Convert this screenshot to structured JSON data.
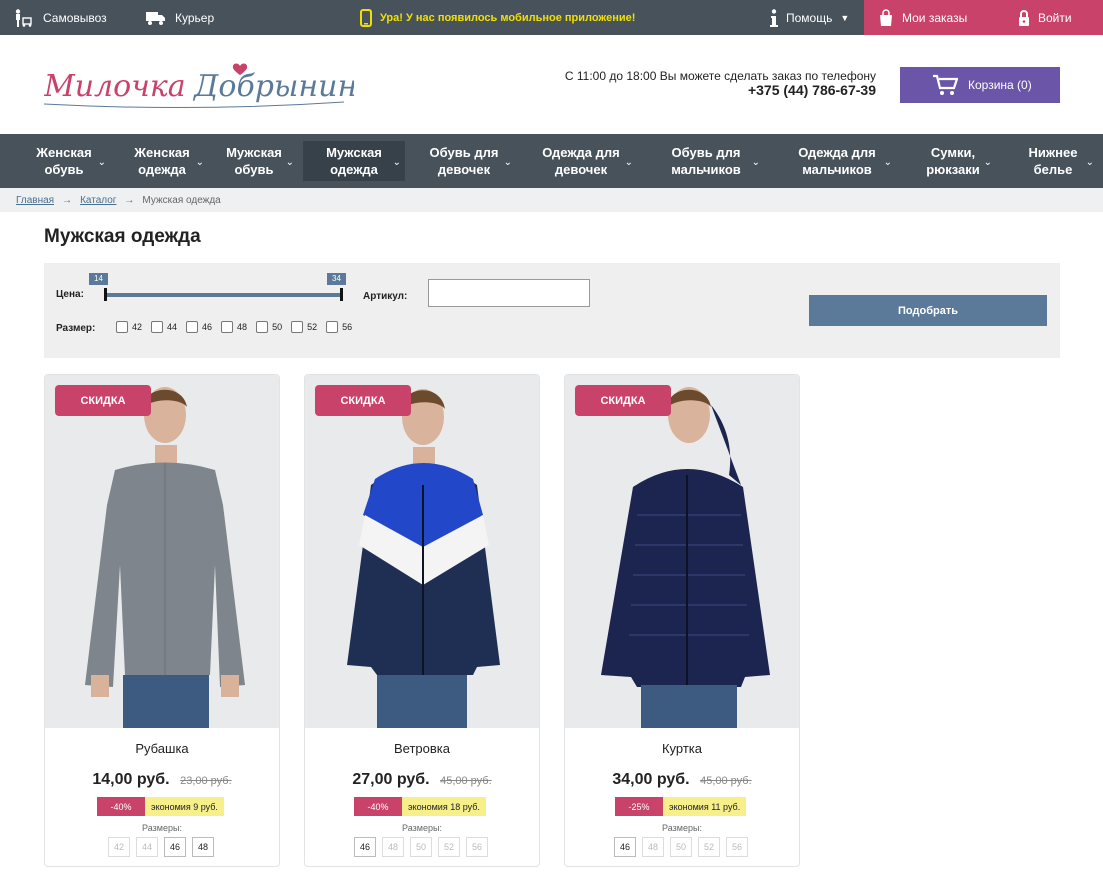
{
  "topbar": {
    "pickup": "Самовывоз",
    "courier": "Курьер",
    "promo": "Ура! У нас появилось мобильное приложение!",
    "help": "Помощь",
    "orders": "Мои заказы",
    "login": "Войти"
  },
  "header": {
    "logo_text": "Милочка Добрынина",
    "phone_note": "С 11:00 до 18:00 Вы можете сделать заказ по телефону",
    "phone": "+375 (44) 786-67-39",
    "cart": "Корзина (0)"
  },
  "nav": {
    "items": [
      {
        "label": "Женская обувь"
      },
      {
        "label": "Женская одежда"
      },
      {
        "label": "Мужская обувь"
      },
      {
        "label": "Мужская одежда",
        "active": true
      },
      {
        "label": "Обувь для девочек"
      },
      {
        "label": "Одежда для девочек"
      },
      {
        "label": "Обувь для мальчиков"
      },
      {
        "label": "Одежда для мальчиков"
      },
      {
        "label": "Сумки, рюкзаки"
      },
      {
        "label": "Нижнее белье"
      }
    ]
  },
  "breadcrumb": {
    "home": "Главная",
    "catalog": "Каталог",
    "current": "Мужская одежда",
    "separator": "→"
  },
  "page_title": "Мужская одежда",
  "filter": {
    "price_label": "Цена:",
    "price_min": "14",
    "price_max": "34",
    "article_label": "Артикул:",
    "article_value": "",
    "size_label": "Размер:",
    "sizes": [
      "42",
      "44",
      "46",
      "48",
      "50",
      "52",
      "56"
    ],
    "submit": "Подобрать"
  },
  "products": [
    {
      "badge": "СКИДКА",
      "name": "Рубашка",
      "price": "14,00 руб.",
      "old_price": "23,00 руб.",
      "discount": "-40%",
      "economy": "экономия 9 руб.",
      "sizes_label": "Размеры:",
      "sizes": [
        {
          "v": "42",
          "available": false
        },
        {
          "v": "44",
          "available": false
        },
        {
          "v": "46",
          "available": true
        },
        {
          "v": "48",
          "available": true
        }
      ]
    },
    {
      "badge": "СКИДКА",
      "name": "Ветровка",
      "price": "27,00 руб.",
      "old_price": "45,00 руб.",
      "discount": "-40%",
      "economy": "экономия 18 руб.",
      "sizes_label": "Размеры:",
      "sizes": [
        {
          "v": "46",
          "available": true
        },
        {
          "v": "48",
          "available": false
        },
        {
          "v": "50",
          "available": false
        },
        {
          "v": "52",
          "available": false
        },
        {
          "v": "56",
          "available": false
        }
      ]
    },
    {
      "badge": "СКИДКА",
      "name": "Куртка",
      "price": "34,00 руб.",
      "old_price": "45,00 руб.",
      "discount": "-25%",
      "economy": "экономия 11 руб.",
      "sizes_label": "Размеры:",
      "sizes": [
        {
          "v": "46",
          "available": true
        },
        {
          "v": "48",
          "available": false
        },
        {
          "v": "50",
          "available": false
        },
        {
          "v": "52",
          "available": false
        },
        {
          "v": "56",
          "available": false
        }
      ]
    }
  ],
  "colors": {
    "dark_bar": "#47525b",
    "accent_pink": "#c9426a",
    "cart_purple": "#6a55a8",
    "filter_blue": "#5b7a99",
    "economy_yellow": "#f7ef8a"
  },
  "icons": {
    "pickup": "pickup-person-icon",
    "courier": "truck-icon",
    "promo": "phone-icon",
    "help": "info-icon",
    "orders": "shopping-bag-icon",
    "login": "lock-icon",
    "cart": "cart-icon"
  }
}
